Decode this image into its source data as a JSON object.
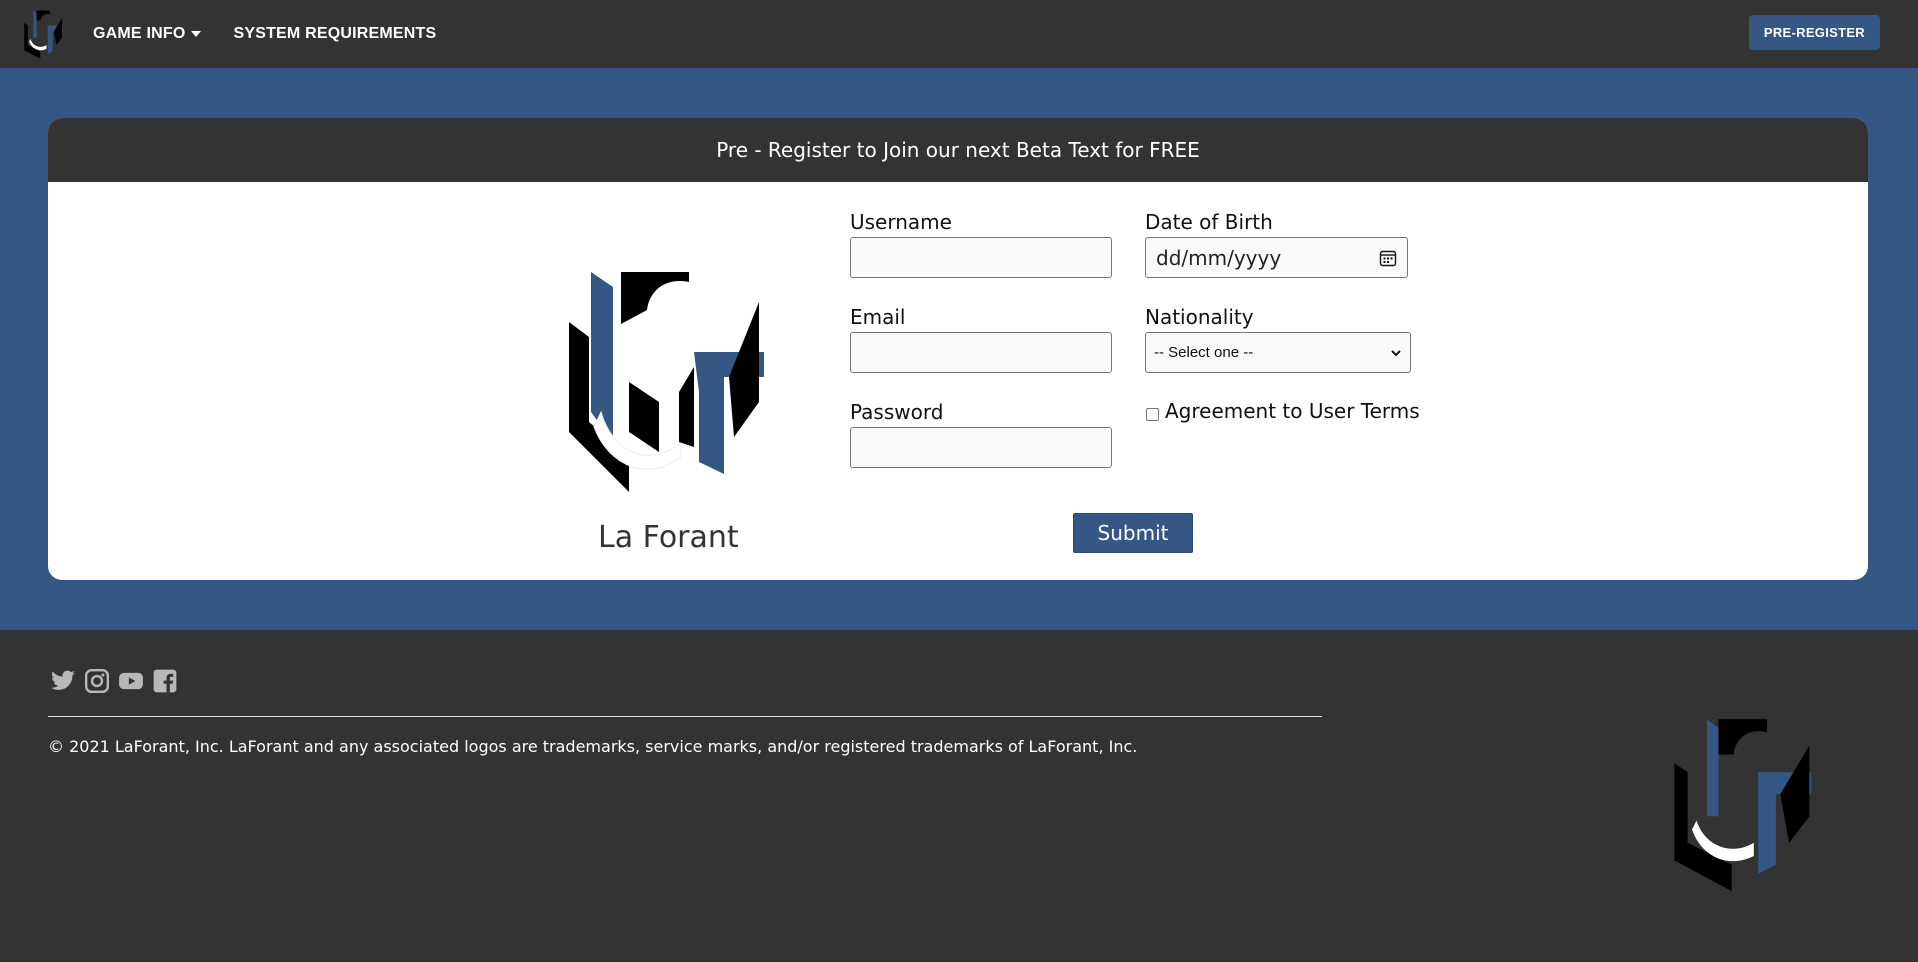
{
  "nav": {
    "logo": "laforant-logo-icon",
    "links": [
      "GAME INFO",
      "SYSTEM REQUIREMENTS"
    ],
    "cta": "PRE-REGISTER"
  },
  "card": {
    "header": "Pre - Register to Join our next Beta Text for FREE",
    "brand_name": "La Forant",
    "form": {
      "username_label": "Username",
      "email_label": "Email",
      "password_label": "Password",
      "dob_label": "Date of Birth",
      "dob_placeholder": "dd/mm/yyyy",
      "nationality_label": "Nationality",
      "nationality_selected": "-- Select one --",
      "agreement_label": "Agreement to User Terms",
      "submit_label": "Submit"
    }
  },
  "footer": {
    "socials": [
      "twitter-icon",
      "instagram-icon",
      "youtube-icon",
      "facebook-icon"
    ],
    "copyright": "© 2021 LaForant, Inc. LaForant and any associated logos are trademarks, service marks, and/or registered trademarks of LaForant, Inc."
  },
  "colors": {
    "primary": "#345783",
    "dark": "#333333",
    "white": "#ffffff"
  }
}
